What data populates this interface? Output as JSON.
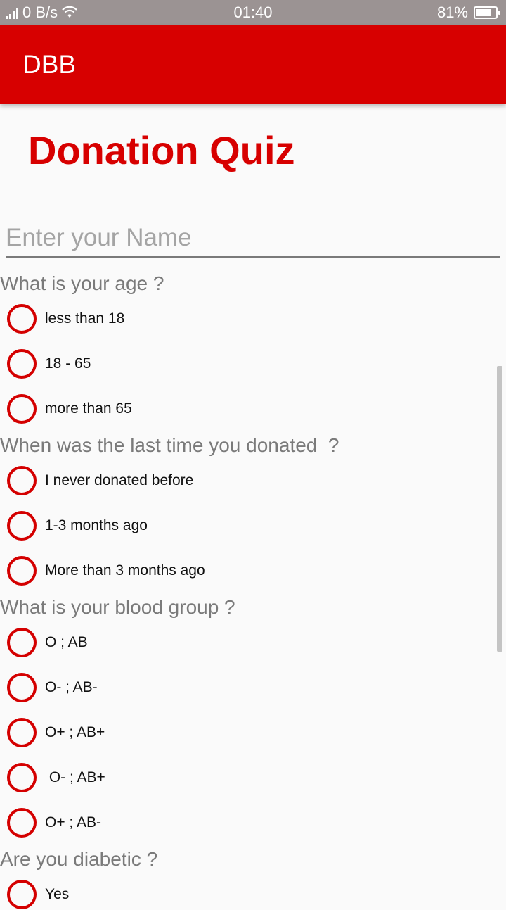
{
  "status_bar": {
    "network_speed": "0 B/s",
    "time": "01:40",
    "battery_percent": "81%",
    "battery_level": 0.81
  },
  "app_bar": {
    "title": "DBB"
  },
  "page": {
    "title": "Donation Quiz"
  },
  "name_input": {
    "placeholder": "Enter your Name",
    "value": ""
  },
  "questions": [
    {
      "text": "What is your age ?",
      "options": [
        "less than 18",
        "18 - 65",
        "more than 65"
      ]
    },
    {
      "text": "When was the last time you donated  ?",
      "options": [
        "I never donated before",
        "1-3 months ago",
        "More than 3 months ago"
      ]
    },
    {
      "text": "What is your blood group ?",
      "options": [
        "O ; AB",
        "O- ; AB-",
        "O+ ; AB+",
        " O- ; AB+",
        "O+ ; AB-"
      ]
    },
    {
      "text": "Are you diabetic ?",
      "options": [
        "Yes"
      ]
    }
  ],
  "colors": {
    "accent": "#d70000",
    "status_bar": "#9b9393",
    "question_text": "#7a7a7a"
  }
}
